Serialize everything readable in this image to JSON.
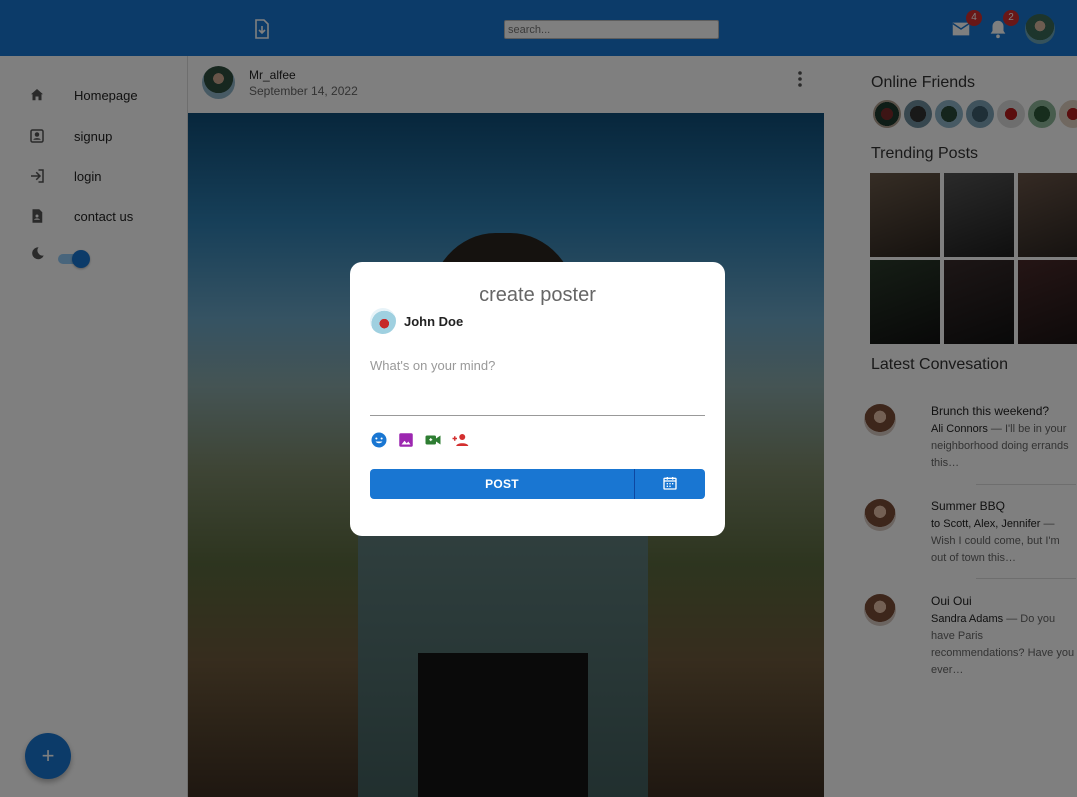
{
  "appbar": {
    "search_placeholder": "search...",
    "mail_badge": "4",
    "notification_badge": "2"
  },
  "sidebar": {
    "items": [
      {
        "label": "Homepage",
        "icon": "home-icon"
      },
      {
        "label": "signup",
        "icon": "account-box-icon"
      },
      {
        "label": "login",
        "icon": "login-icon"
      },
      {
        "label": "contact us",
        "icon": "contact-page-icon"
      }
    ],
    "theme_toggle_icon": "moon-icon",
    "fab_label": "+"
  },
  "post": {
    "user": "Mr_alfee",
    "date": "September 14, 2022"
  },
  "right": {
    "online_friends_title": "Online Friends",
    "trending_title": "Trending Posts",
    "latest_title": "Latest Convesation",
    "conversations": [
      {
        "title": "Brunch this weekend?",
        "from": "Ali Connors",
        "text": " — I'll be in your neighborhood doing errands this…"
      },
      {
        "title": "Summer BBQ",
        "from": "to Scott, Alex, Jennifer",
        "text": " — Wish I could come, but I'm out of town this…"
      },
      {
        "title": "Oui Oui",
        "from": "Sandra Adams",
        "text": " — Do you have Paris recommendations? Have you ever…"
      }
    ]
  },
  "modal": {
    "title": "create poster",
    "user": "John Doe",
    "placeholder": "What's on your mind?",
    "post_label": "POST"
  },
  "colors": {
    "primary": "#1976d2",
    "badge": "#d32f2f",
    "emoji_icon": "#1976d2",
    "image_icon": "#9c27b0",
    "video_icon": "#2e7d32",
    "add_person_icon": "#d32f2f"
  }
}
